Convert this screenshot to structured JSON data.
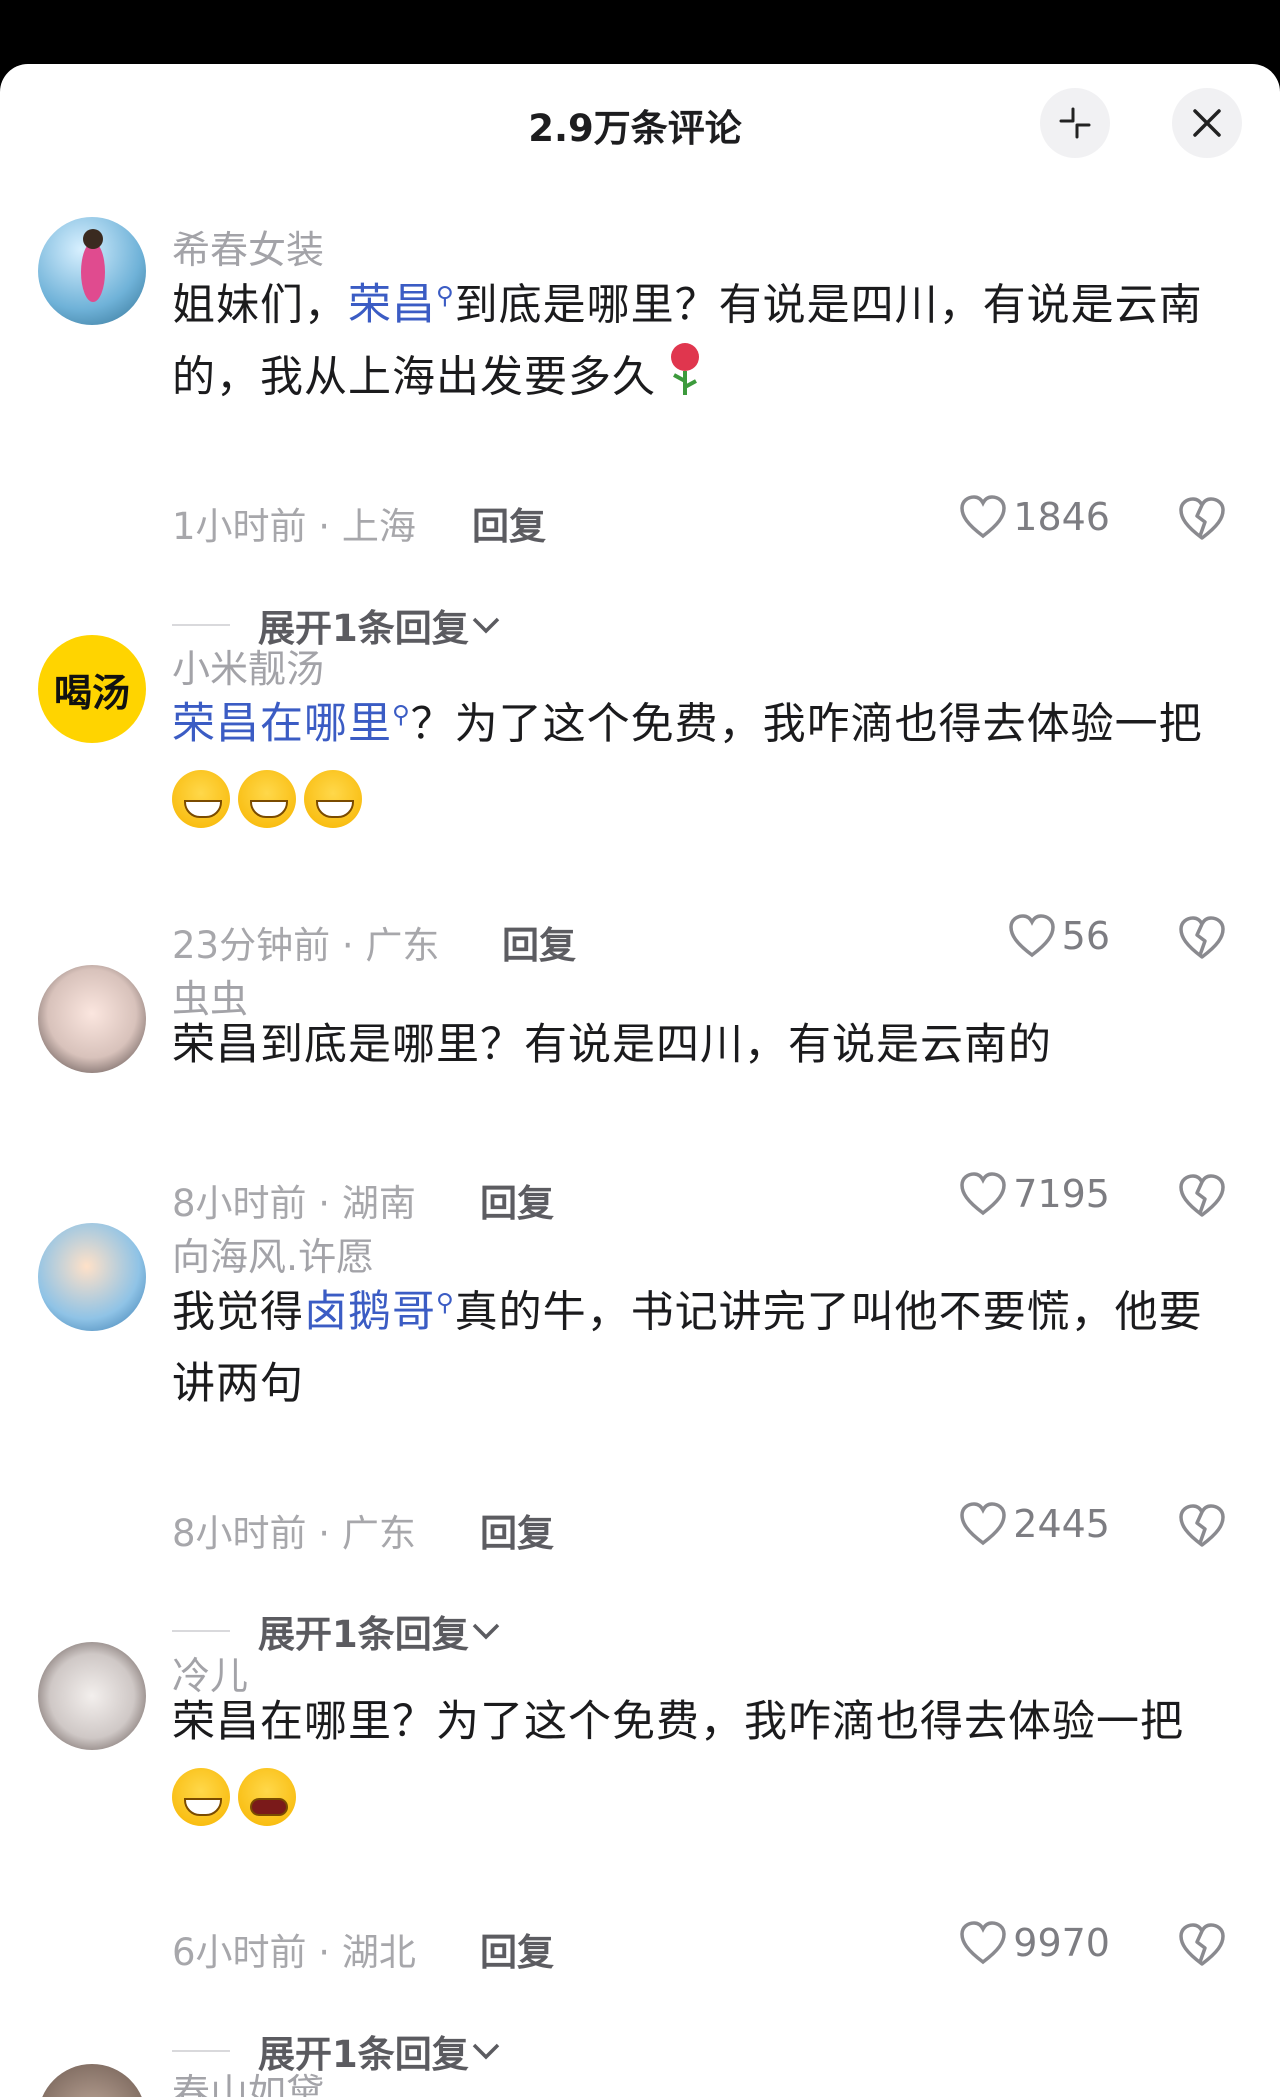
{
  "header": {
    "title": "2.9万条评论"
  },
  "comments": [
    {
      "name": "希春女装",
      "text_before": "姐妹们，",
      "tag": "荣昌",
      "text_after": "到底是哪里？有说是四川，有说是云南的，我从上海出发要多久",
      "emoji": "rose",
      "time_location": "1小时前 · 上海",
      "reply": "回复",
      "likes": "1846",
      "expand": "展开1条回复"
    },
    {
      "name": "小米靓汤",
      "avatar_text": "喝汤",
      "tag": "荣昌在哪里",
      "text_after": "？为了这个免费，我咋滴也得去体验一把",
      "time_location": "23分钟前 · 广东",
      "reply": "回复",
      "likes": "56"
    },
    {
      "name": "虫虫",
      "text": "荣昌到底是哪里？有说是四川，有说是云南的",
      "time_location": "8小时前 · 湖南",
      "reply": "回复",
      "likes": "7195"
    },
    {
      "name": "向海风.许愿",
      "text_before": "我觉得",
      "tag": "卤鹅哥",
      "text_after": "真的牛，书记讲完了叫他不要慌，他要讲两句",
      "time_location": "8小时前 · 广东",
      "reply": "回复",
      "likes": "2445",
      "expand": "展开1条回复"
    },
    {
      "name": "冷儿",
      "text": "荣昌在哪里？为了这个免费，我咋滴也得去体验一把",
      "time_location": "6小时前 · 湖北",
      "reply": "回复",
      "likes": "9970",
      "expand": "展开1条回复"
    },
    {
      "name": "春山如黛"
    }
  ],
  "colors": {
    "tag": "#3b5cc4",
    "background": "#ffffff",
    "muted": "#a3a3a8"
  }
}
